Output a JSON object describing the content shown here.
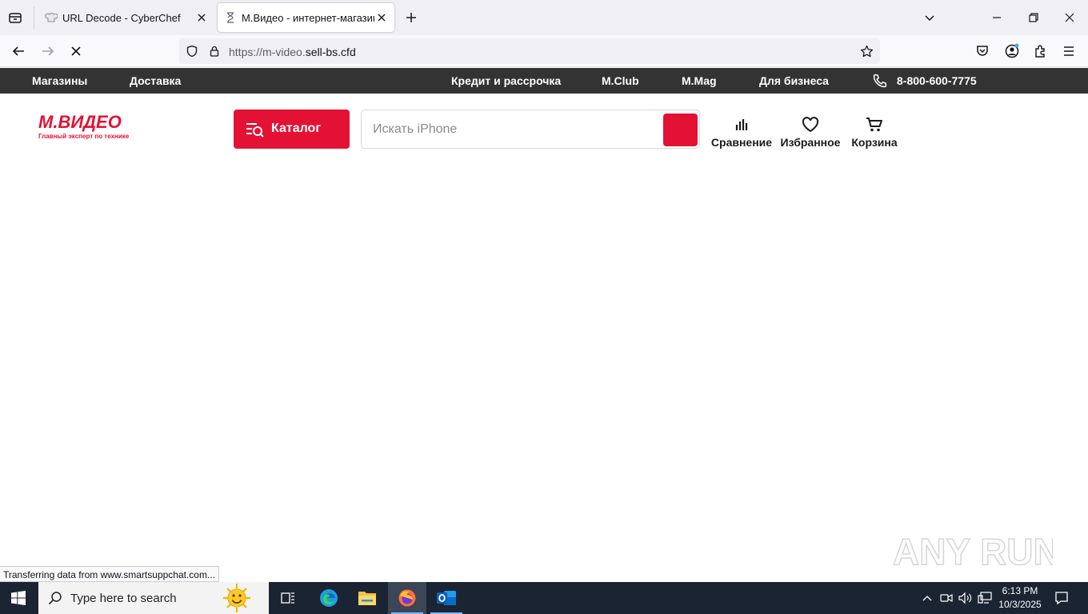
{
  "browser": {
    "tabs": [
      {
        "title": "URL Decode - CyberChef",
        "active": false
      },
      {
        "title": "М.Видео - интернет-магазин ц",
        "active": true
      }
    ],
    "url_host_dim": "https://m-video.",
    "url_host_main": "sell-bs.cfd",
    "status": "Transferring data from www.smartsuppchat.com..."
  },
  "site": {
    "topbar": {
      "left": [
        "Магазины",
        "Доставка"
      ],
      "right": [
        "Кредит и рассрочка",
        "M.Club",
        "M.Mag",
        "Для бизнеса"
      ],
      "phone": "8-800-600-7775"
    },
    "logo": {
      "name": "М.ВИДЕО",
      "tagline": "Главный эксперт по технике"
    },
    "catalog_label": "Каталог",
    "search_placeholder": "Искать iPhone",
    "actions": {
      "compare": "Сравнение",
      "favorites": "Избранное",
      "cart": "Корзина"
    },
    "accent": "#e31235"
  },
  "taskbar": {
    "search_label": "Type here to search",
    "time": "6:13 PM",
    "date": "10/3/2025"
  },
  "watermark": "ANY RUN"
}
